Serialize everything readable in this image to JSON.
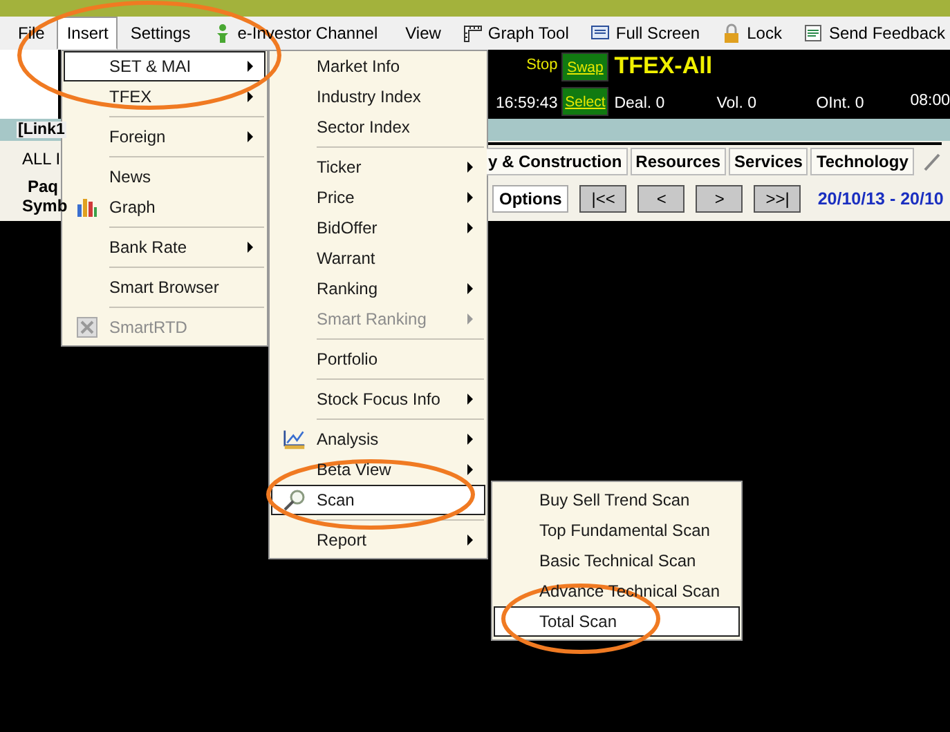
{
  "menu_bar": [
    {
      "label": "File",
      "selected": false
    },
    {
      "label": "Insert",
      "selected": true
    },
    {
      "label": "Settings",
      "selected": false
    },
    {
      "label": "e-Investor Channel",
      "selected": false
    },
    {
      "label": "View",
      "selected": false
    },
    {
      "label": "Graph Tool",
      "selected": false
    },
    {
      "label": "Full Screen",
      "selected": false
    },
    {
      "label": "Lock",
      "selected": false
    },
    {
      "label": "Send Feedback",
      "selected": false
    }
  ],
  "ticker": {
    "status": "Stop",
    "time": "16:59:43",
    "swap_button": "Swap",
    "select_button": "Select",
    "symbol": "TFEX-All",
    "deal": "Deal. 0",
    "volume": "Vol. 0",
    "open_interest": "OInt. 0",
    "time_2": "08:00"
  },
  "window": {
    "title": "[Link1",
    "filter": "ALL I",
    "group_label": "Paq",
    "column_label": "Symb",
    "sector_tabs": [
      "y & Construction",
      "Resources",
      "Services",
      "Technology"
    ],
    "options_button": "Options",
    "nav_buttons": [
      "|<<",
      "<",
      ">",
      ">>|"
    ],
    "date_range": "20/10/13 - 20/10"
  },
  "menus": [
    {
      "items": [
        {
          "kind": "item",
          "label": "SET & MAI",
          "submenu": true,
          "disabled": false,
          "selected": true
        },
        {
          "kind": "item",
          "label": "TFEX",
          "submenu": true,
          "disabled": false,
          "selected": false
        },
        {
          "kind": "separator"
        },
        {
          "kind": "item",
          "label": "Foreign",
          "submenu": true,
          "disabled": false,
          "selected": false
        },
        {
          "kind": "separator"
        },
        {
          "kind": "item",
          "label": "News",
          "submenu": false,
          "disabled": false,
          "selected": false
        },
        {
          "kind": "item",
          "label": "Graph",
          "submenu": false,
          "disabled": false,
          "selected": false
        },
        {
          "kind": "separator"
        },
        {
          "kind": "item",
          "label": "Bank Rate",
          "submenu": true,
          "disabled": false,
          "selected": false
        },
        {
          "kind": "separator"
        },
        {
          "kind": "item",
          "label": "Smart Browser",
          "submenu": false,
          "disabled": false,
          "selected": false
        },
        {
          "kind": "separator"
        },
        {
          "kind": "item",
          "label": "SmartRTD",
          "submenu": false,
          "disabled": true,
          "selected": false
        }
      ]
    },
    {
      "items": [
        {
          "kind": "item",
          "label": "Market Info",
          "submenu": false,
          "disabled": false,
          "selected": false
        },
        {
          "kind": "item",
          "label": "Industry Index",
          "submenu": false,
          "disabled": false,
          "selected": false
        },
        {
          "kind": "item",
          "label": "Sector Index",
          "submenu": false,
          "disabled": false,
          "selected": false
        },
        {
          "kind": "separator"
        },
        {
          "kind": "item",
          "label": "Ticker",
          "submenu": true,
          "disabled": false,
          "selected": false
        },
        {
          "kind": "item",
          "label": "Price",
          "submenu": true,
          "disabled": false,
          "selected": false
        },
        {
          "kind": "item",
          "label": "BidOffer",
          "submenu": true,
          "disabled": false,
          "selected": false
        },
        {
          "kind": "item",
          "label": "Warrant",
          "submenu": false,
          "disabled": false,
          "selected": false
        },
        {
          "kind": "item",
          "label": "Ranking",
          "submenu": true,
          "disabled": false,
          "selected": false
        },
        {
          "kind": "item",
          "label": "Smart Ranking",
          "submenu": true,
          "disabled": true,
          "selected": false
        },
        {
          "kind": "separator"
        },
        {
          "kind": "item",
          "label": "Portfolio",
          "submenu": false,
          "disabled": false,
          "selected": false
        },
        {
          "kind": "separator"
        },
        {
          "kind": "item",
          "label": "Stock Focus Info",
          "submenu": true,
          "disabled": false,
          "selected": false
        },
        {
          "kind": "separator"
        },
        {
          "kind": "item",
          "label": "Analysis",
          "submenu": true,
          "disabled": false,
          "selected": false
        },
        {
          "kind": "item",
          "label": "Beta View",
          "submenu": true,
          "disabled": false,
          "selected": false
        },
        {
          "kind": "item",
          "label": "Scan",
          "submenu": false,
          "disabled": false,
          "selected": true
        },
        {
          "kind": "separator"
        },
        {
          "kind": "item",
          "label": "Report",
          "submenu": true,
          "disabled": false,
          "selected": false
        }
      ]
    },
    {
      "items": [
        {
          "kind": "item",
          "label": "Buy Sell Trend Scan",
          "submenu": false,
          "disabled": false,
          "selected": false
        },
        {
          "kind": "item",
          "label": "Top Fundamental Scan",
          "submenu": false,
          "disabled": false,
          "selected": false
        },
        {
          "kind": "item",
          "label": "Basic Technical Scan",
          "submenu": false,
          "disabled": false,
          "selected": false
        },
        {
          "kind": "item",
          "label": "Advance Technical Scan",
          "submenu": false,
          "disabled": false,
          "selected": false
        },
        {
          "kind": "item",
          "label": "Total Scan",
          "submenu": false,
          "disabled": false,
          "selected": true
        }
      ]
    }
  ]
}
